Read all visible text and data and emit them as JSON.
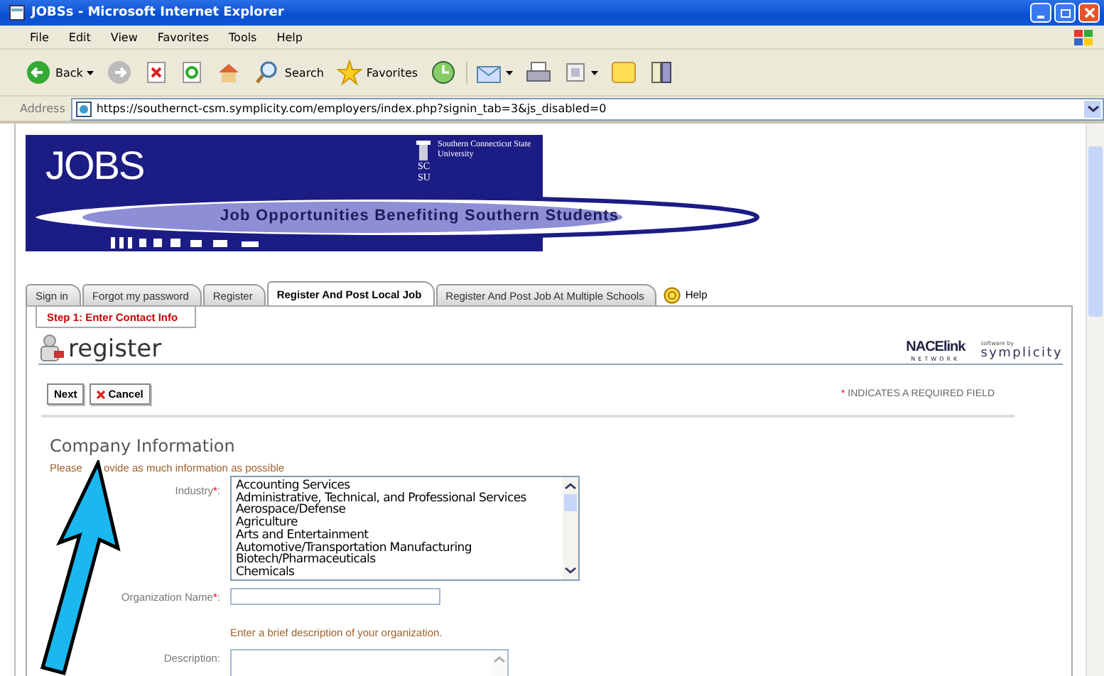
{
  "window": {
    "title": "JOBSs - Microsoft Internet Explorer"
  },
  "menu": [
    "File",
    "Edit",
    "View",
    "Favorites",
    "Tools",
    "Help"
  ],
  "toolbar": [
    {
      "kind": "back",
      "label": "Back"
    },
    {
      "kind": "forward"
    },
    {
      "kind": "stop"
    },
    {
      "kind": "refresh"
    },
    {
      "kind": "home"
    },
    {
      "kind": "search",
      "label": "Search"
    },
    {
      "kind": "favorites",
      "label": "Favorites"
    },
    {
      "kind": "history"
    },
    {
      "kind": "mail"
    },
    {
      "kind": "print"
    },
    {
      "kind": "edit"
    },
    {
      "kind": "note"
    },
    {
      "kind": "research"
    }
  ],
  "address": {
    "label": "Address",
    "value": "https://southernct-csm.symplicity.com/employers/index.php?signin_tab=3&js_disabled=0"
  },
  "banner": {
    "logo": "JOBS",
    "university": "Southern Connecticut State University",
    "monogram": "SCSU",
    "tagline": "Job Opportunities Benefiting Southern Students"
  },
  "tabs": [
    {
      "label": "Sign in",
      "selected": false
    },
    {
      "label": "Forgot my password",
      "selected": false
    },
    {
      "label": "Register",
      "selected": false
    },
    {
      "label": "Register And Post Local Job",
      "selected": true
    },
    {
      "label": "Register And Post Job At Multiple Schools",
      "selected": false
    }
  ],
  "help": "Help",
  "subtabs": [
    {
      "label": "Step 1: Enter Contact Info",
      "selected": true
    }
  ],
  "page_title": "register",
  "brand": {
    "nacelink": "NACElink",
    "network": "NETWORK",
    "caption": "software by",
    "symplicity": "symplicity"
  },
  "actions": [
    {
      "kind": "next",
      "label": "Next"
    },
    {
      "kind": "cancel",
      "label": "Cancel"
    }
  ],
  "required_note": {
    "mark": "*",
    "text": "INDICATES A REQUIRED FIELD"
  },
  "section": {
    "title": "Company Information",
    "hint_parts": [
      "Please",
      "ovide as much information as possible"
    ]
  },
  "label_colon": ":",
  "fields": [
    {
      "kind": "select",
      "label": "Industry",
      "required": true,
      "options": [
        "Accounting Services",
        "Administrative, Technical, and Professional Services",
        "Aerospace/Defense",
        "Agriculture",
        "Arts and Entertainment",
        "Automotive/Transportation Manufacturing",
        "Biotech/Pharmaceuticals",
        "Chemicals"
      ]
    },
    {
      "kind": "text",
      "label": "Organization Name",
      "required": true
    },
    {
      "kind": "textarea",
      "label": "Description",
      "required": false,
      "help": "Enter a brief description of your organization."
    }
  ]
}
